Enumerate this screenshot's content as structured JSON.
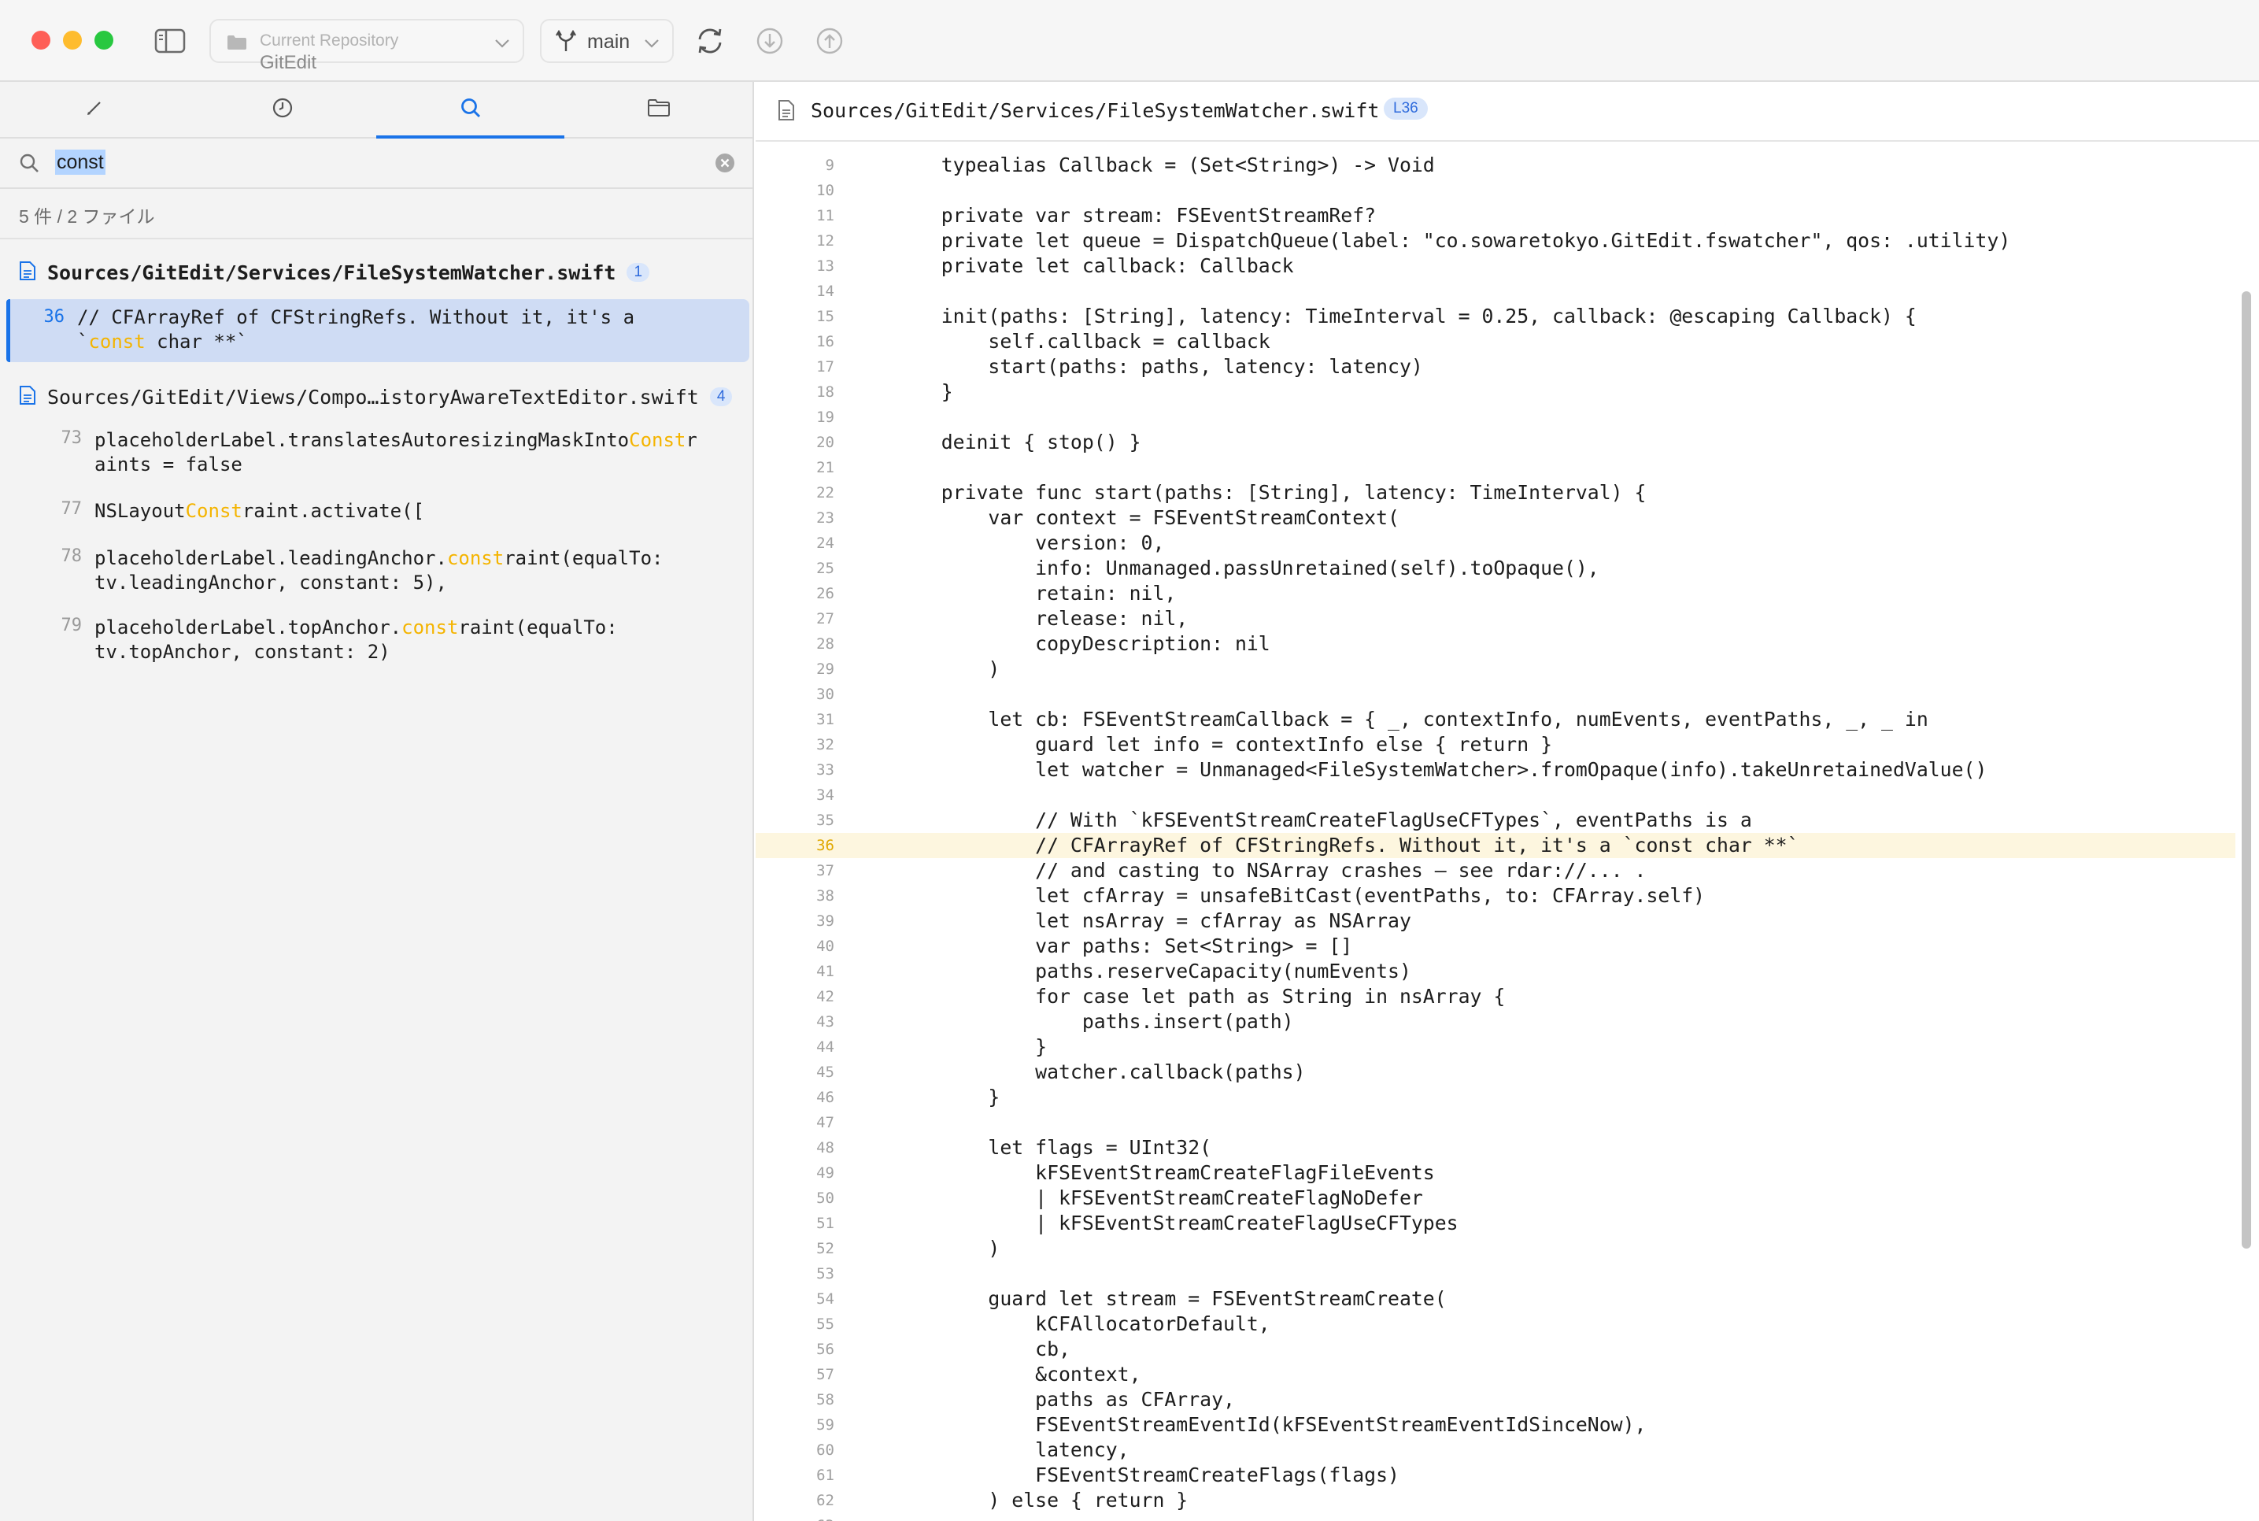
{
  "toolbar": {
    "repo_caption": "Current Repository",
    "repo_name": "GitEdit",
    "branch": "main"
  },
  "sidebar": {
    "search_value": "const",
    "summary": "5 件 / 2 ファイル",
    "files": [
      {
        "name": "Sources/GitEdit/Services/FileSystemWatcher.swift",
        "count": "1",
        "results": [
          {
            "line": "36",
            "parts": [
              "// CFArrayRef of CFStringRefs. Without it, it's a\n`",
              "const",
              " char **`"
            ]
          }
        ]
      },
      {
        "name": "Sources/GitEdit/Views/Compo…istoryAwareTextEditor.swift",
        "count": "4",
        "results": [
          {
            "line": "73",
            "parts": [
              "placeholderLabel.translatesAutoresizingMaskInto",
              "Const",
              "r\naints = false"
            ]
          },
          {
            "line": "77",
            "parts": [
              "NSLayout",
              "Const",
              "raint.activate(["
            ]
          },
          {
            "line": "78",
            "parts": [
              "placeholderLabel.leadingAnchor.",
              "const",
              "raint(equalTo:\ntv.leadingAnchor, constant: 5),"
            ]
          },
          {
            "line": "79",
            "parts": [
              "placeholderLabel.topAnchor.",
              "const",
              "raint(equalTo:\ntv.topAnchor, constant: 2)"
            ]
          }
        ]
      }
    ]
  },
  "editor": {
    "path": "Sources/GitEdit/Services/FileSystemWatcher.swift",
    "line_badge": "L36",
    "current_line": "36",
    "lines": [
      {
        "n": "9",
        "t": "    typealias Callback = (Set<String>) -> Void"
      },
      {
        "n": "10",
        "t": ""
      },
      {
        "n": "11",
        "t": "    private var stream: FSEventStreamRef?"
      },
      {
        "n": "12",
        "t": "    private let queue = DispatchQueue(label: \"co.sowaretokyo.GitEdit.fswatcher\", qos: .utility)"
      },
      {
        "n": "13",
        "t": "    private let callback: Callback"
      },
      {
        "n": "14",
        "t": ""
      },
      {
        "n": "15",
        "t": "    init(paths: [String], latency: TimeInterval = 0.25, callback: @escaping Callback) {"
      },
      {
        "n": "16",
        "t": "        self.callback = callback"
      },
      {
        "n": "17",
        "t": "        start(paths: paths, latency: latency)"
      },
      {
        "n": "18",
        "t": "    }"
      },
      {
        "n": "19",
        "t": ""
      },
      {
        "n": "20",
        "t": "    deinit { stop() }"
      },
      {
        "n": "21",
        "t": ""
      },
      {
        "n": "22",
        "t": "    private func start(paths: [String], latency: TimeInterval) {"
      },
      {
        "n": "23",
        "t": "        var context = FSEventStreamContext("
      },
      {
        "n": "24",
        "t": "            version: 0,"
      },
      {
        "n": "25",
        "t": "            info: Unmanaged.passUnretained(self).toOpaque(),"
      },
      {
        "n": "26",
        "t": "            retain: nil,"
      },
      {
        "n": "27",
        "t": "            release: nil,"
      },
      {
        "n": "28",
        "t": "            copyDescription: nil"
      },
      {
        "n": "29",
        "t": "        )"
      },
      {
        "n": "30",
        "t": ""
      },
      {
        "n": "31",
        "t": "        let cb: FSEventStreamCallback = { _, contextInfo, numEvents, eventPaths, _, _ in"
      },
      {
        "n": "32",
        "t": "            guard let info = contextInfo else { return }"
      },
      {
        "n": "33",
        "t": "            let watcher = Unmanaged<FileSystemWatcher>.fromOpaque(info).takeUnretainedValue()"
      },
      {
        "n": "34",
        "t": ""
      },
      {
        "n": "35",
        "t": "            // With `kFSEventStreamCreateFlagUseCFTypes`, eventPaths is a"
      },
      {
        "n": "36",
        "t": "            // CFArrayRef of CFStringRefs. Without it, it's a `const char **`"
      },
      {
        "n": "37",
        "t": "            // and casting to NSArray crashes — see rdar://... ."
      },
      {
        "n": "38",
        "t": "            let cfArray = unsafeBitCast(eventPaths, to: CFArray.self)"
      },
      {
        "n": "39",
        "t": "            let nsArray = cfArray as NSArray"
      },
      {
        "n": "40",
        "t": "            var paths: Set<String> = []"
      },
      {
        "n": "41",
        "t": "            paths.reserveCapacity(numEvents)"
      },
      {
        "n": "42",
        "t": "            for case let path as String in nsArray {"
      },
      {
        "n": "43",
        "t": "                paths.insert(path)"
      },
      {
        "n": "44",
        "t": "            }"
      },
      {
        "n": "45",
        "t": "            watcher.callback(paths)"
      },
      {
        "n": "46",
        "t": "        }"
      },
      {
        "n": "47",
        "t": ""
      },
      {
        "n": "48",
        "t": "        let flags = UInt32("
      },
      {
        "n": "49",
        "t": "            kFSEventStreamCreateFlagFileEvents"
      },
      {
        "n": "50",
        "t": "            | kFSEventStreamCreateFlagNoDefer"
      },
      {
        "n": "51",
        "t": "            | kFSEventStreamCreateFlagUseCFTypes"
      },
      {
        "n": "52",
        "t": "        )"
      },
      {
        "n": "53",
        "t": ""
      },
      {
        "n": "54",
        "t": "        guard let stream = FSEventStreamCreate("
      },
      {
        "n": "55",
        "t": "            kCFAllocatorDefault,"
      },
      {
        "n": "56",
        "t": "            cb,"
      },
      {
        "n": "57",
        "t": "            &context,"
      },
      {
        "n": "58",
        "t": "            paths as CFArray,"
      },
      {
        "n": "59",
        "t": "            FSEventStreamEventId(kFSEventStreamEventIdSinceNow),"
      },
      {
        "n": "60",
        "t": "            latency,"
      },
      {
        "n": "61",
        "t": "            FSEventStreamCreateFlags(flags)"
      },
      {
        "n": "62",
        "t": "        ) else { return }"
      },
      {
        "n": "63",
        "t": ""
      }
    ]
  }
}
